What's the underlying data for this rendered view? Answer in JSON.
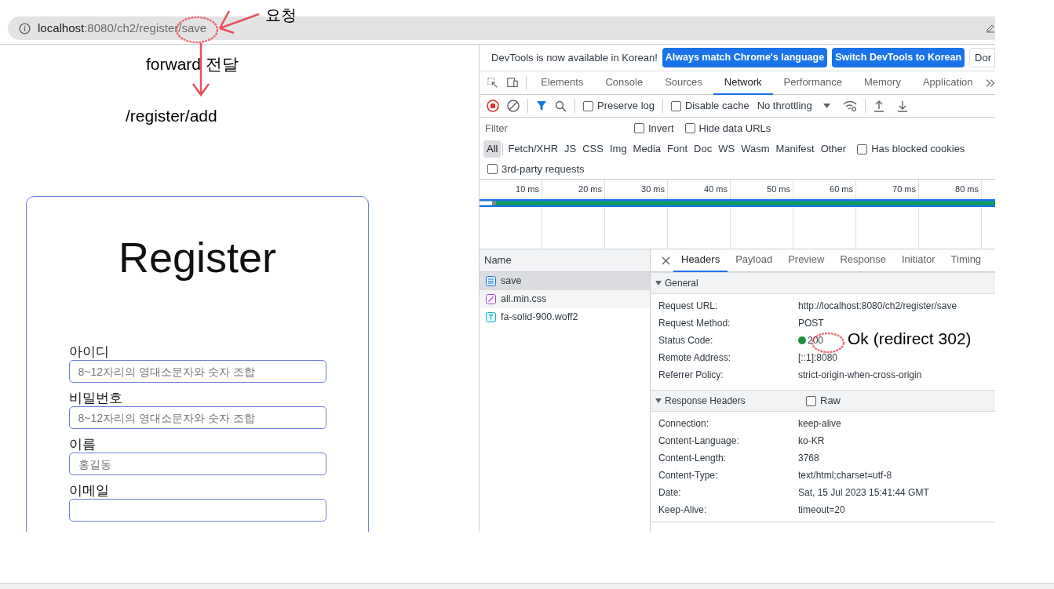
{
  "address_bar": {
    "host": "localhost",
    "path": ":8080/ch2/register/save"
  },
  "annotations": {
    "request": "요청",
    "forward": "forward 전달",
    "target": "/register/add",
    "status_note": "Ok (redirect 302)"
  },
  "register": {
    "title": "Register",
    "fields": [
      {
        "label": "아이디",
        "placeholder": "8~12자리의 영대소문자와 숫자 조합"
      },
      {
        "label": "비밀번호",
        "placeholder": "8~12자리의 영대소문자와 숫자 조합"
      },
      {
        "label": "이름",
        "placeholder": "홍길동"
      },
      {
        "label": "이메일"
      }
    ]
  },
  "devtools": {
    "infobar": {
      "message": "DevTools is now available in Korean!",
      "buttons": [
        {
          "label": "Always match Chrome's language",
          "kind": "primary"
        },
        {
          "label": "Switch DevTools to Korean",
          "kind": "primary"
        },
        {
          "label": "Dor",
          "kind": "plain"
        }
      ]
    },
    "tabs": [
      {
        "label": "Elements",
        "selected": false
      },
      {
        "label": "Console",
        "selected": false
      },
      {
        "label": "Sources",
        "selected": false
      },
      {
        "label": "Network",
        "selected": true
      },
      {
        "label": "Performance",
        "selected": false
      },
      {
        "label": "Memory",
        "selected": false
      },
      {
        "label": "Application",
        "selected": false
      }
    ],
    "toolbar": {
      "preserve_log": {
        "label": "Preserve log",
        "checked": false
      },
      "disable_cache": {
        "label": "Disable cache",
        "checked": false
      },
      "throttling": "No throttling"
    },
    "filter": {
      "placeholder": "Filter",
      "options": [
        {
          "label": "Invert",
          "checked": false
        },
        {
          "label": "Hide data URLs",
          "checked": false
        }
      ]
    },
    "types": [
      {
        "label": "All",
        "selected": true
      },
      {
        "label": "Fetch/XHR",
        "selected": false
      },
      {
        "label": "JS",
        "selected": false
      },
      {
        "label": "CSS",
        "selected": false
      },
      {
        "label": "Img",
        "selected": false
      },
      {
        "label": "Media",
        "selected": false
      },
      {
        "label": "Font",
        "selected": false
      },
      {
        "label": "Doc",
        "selected": false
      },
      {
        "label": "WS",
        "selected": false
      },
      {
        "label": "Wasm",
        "selected": false
      },
      {
        "label": "Manifest",
        "selected": false
      },
      {
        "label": "Other",
        "selected": false
      }
    ],
    "blocked_cookies": {
      "label": "Has blocked cookies",
      "checked": false
    },
    "third_party": {
      "label": "3rd-party requests",
      "checked": false
    },
    "timeline_ticks": [
      "10 ms",
      "20 ms",
      "30 ms",
      "40 ms",
      "50 ms",
      "60 ms",
      "70 ms",
      "80 ms"
    ],
    "requests_header": "Name",
    "requests": [
      {
        "name": "save",
        "kind": "document",
        "selected": true
      },
      {
        "name": "all.min.css",
        "kind": "stylesheet",
        "selected": false
      },
      {
        "name": "fa-solid-900.woff2",
        "kind": "font",
        "selected": false
      }
    ],
    "detail_tabs": [
      {
        "label": "Headers",
        "selected": true
      },
      {
        "label": "Payload",
        "selected": false
      },
      {
        "label": "Preview",
        "selected": false
      },
      {
        "label": "Response",
        "selected": false
      },
      {
        "label": "Initiator",
        "selected": false
      },
      {
        "label": "Timing",
        "selected": false
      }
    ],
    "general": {
      "title": "General",
      "expanded": true,
      "rows": [
        {
          "key": "Request URL:",
          "value": "http://localhost:8080/ch2/register/save"
        },
        {
          "key": "Request Method:",
          "value": "POST"
        },
        {
          "key": "Status Code:",
          "value": "200",
          "kind": "status"
        },
        {
          "key": "Remote Address:",
          "value": "[::1]:8080"
        },
        {
          "key": "Referrer Policy:",
          "value": "strict-origin-when-cross-origin"
        }
      ]
    },
    "response_headers": {
      "title": "Response Headers",
      "expanded": true,
      "raw": {
        "label": "Raw",
        "checked": false
      },
      "rows": [
        {
          "key": "Connection:",
          "value": "keep-alive"
        },
        {
          "key": "Content-Language:",
          "value": "ko-KR"
        },
        {
          "key": "Content-Length:",
          "value": "3768"
        },
        {
          "key": "Content-Type:",
          "value": "text/html;charset=utf-8"
        },
        {
          "key": "Date:",
          "value": "Sat, 15 Jul 2023 15:41:44 GMT"
        },
        {
          "key": "Keep-Alive:",
          "value": "timeout=20"
        }
      ]
    }
  }
}
